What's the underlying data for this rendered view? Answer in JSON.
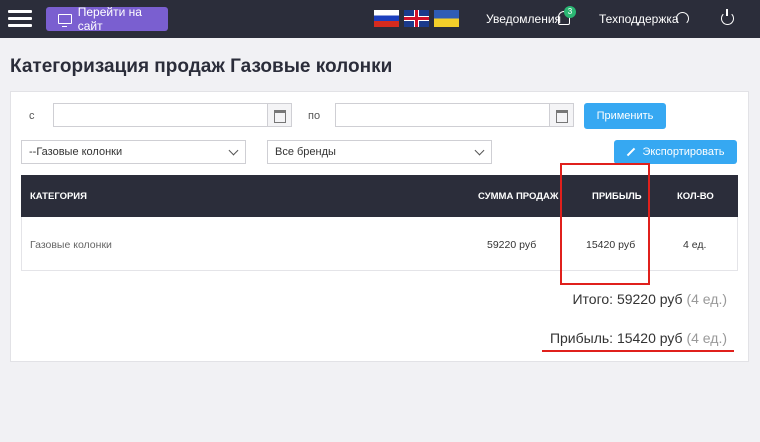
{
  "topbar": {
    "site_button_label": "Перейти на сайт",
    "notifications_label": "Уведомления",
    "notifications_count": "3",
    "support_label": "Техподдержка",
    "flags": [
      "ru",
      "uk",
      "ua"
    ]
  },
  "page": {
    "title": "Категоризация продаж Газовые колонки"
  },
  "filters": {
    "from_label": "с",
    "to_label": "по",
    "from_value": "",
    "to_value": "",
    "apply_label": "Применить",
    "category_selected": "--Газовые колонки",
    "brand_selected": "Все бренды",
    "export_label": "Экспортировать"
  },
  "table": {
    "headers": [
      "КАТЕГОРИЯ",
      "СУММА ПРОДАЖ",
      "ПРИБЫЛЬ",
      "КОЛ-ВО"
    ],
    "rows": [
      {
        "category": "Газовые колонки",
        "sum": "59220 руб",
        "profit": "15420 руб",
        "qty": "4 ед."
      }
    ]
  },
  "totals": {
    "total_label": "Итого:",
    "total_value": "59220 руб",
    "total_qty": "(4 ед.)",
    "profit_label": "Прибыль:",
    "profit_value": "15420 руб",
    "profit_qty": "(4 ед.)"
  },
  "colors": {
    "topbar": "#2b2d3a",
    "site_button": "#7a5fd0",
    "primary_button": "#36a8f2",
    "annotation_red": "#e0201c",
    "badge": "#2bb673"
  }
}
